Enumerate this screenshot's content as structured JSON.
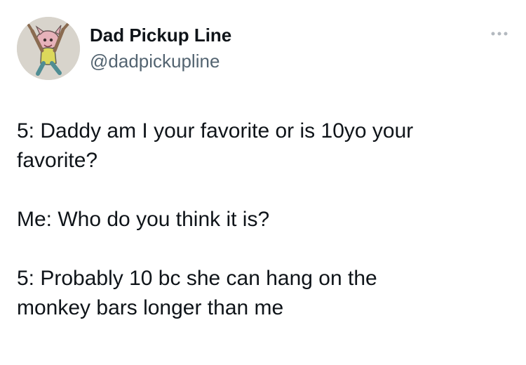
{
  "author": {
    "display_name": "Dad Pickup Line",
    "handle": "@dadpickupline",
    "avatar_icon": "cartoon-avatar-icon"
  },
  "actions": {
    "more_icon": "more-options-icon"
  },
  "tweet": {
    "paragraphs": [
      {
        "lines": [
          "5: Daddy am I your favorite or is 10yo your",
          "favorite?"
        ]
      },
      {
        "lines": [
          "Me: Who do you think it is?"
        ]
      },
      {
        "lines": [
          "5: Probably 10 bc she can hang on the",
          "monkey bars longer than me"
        ]
      }
    ]
  },
  "colors": {
    "text_primary": "#0f1419",
    "text_secondary": "#536471",
    "background": "#ffffff"
  }
}
